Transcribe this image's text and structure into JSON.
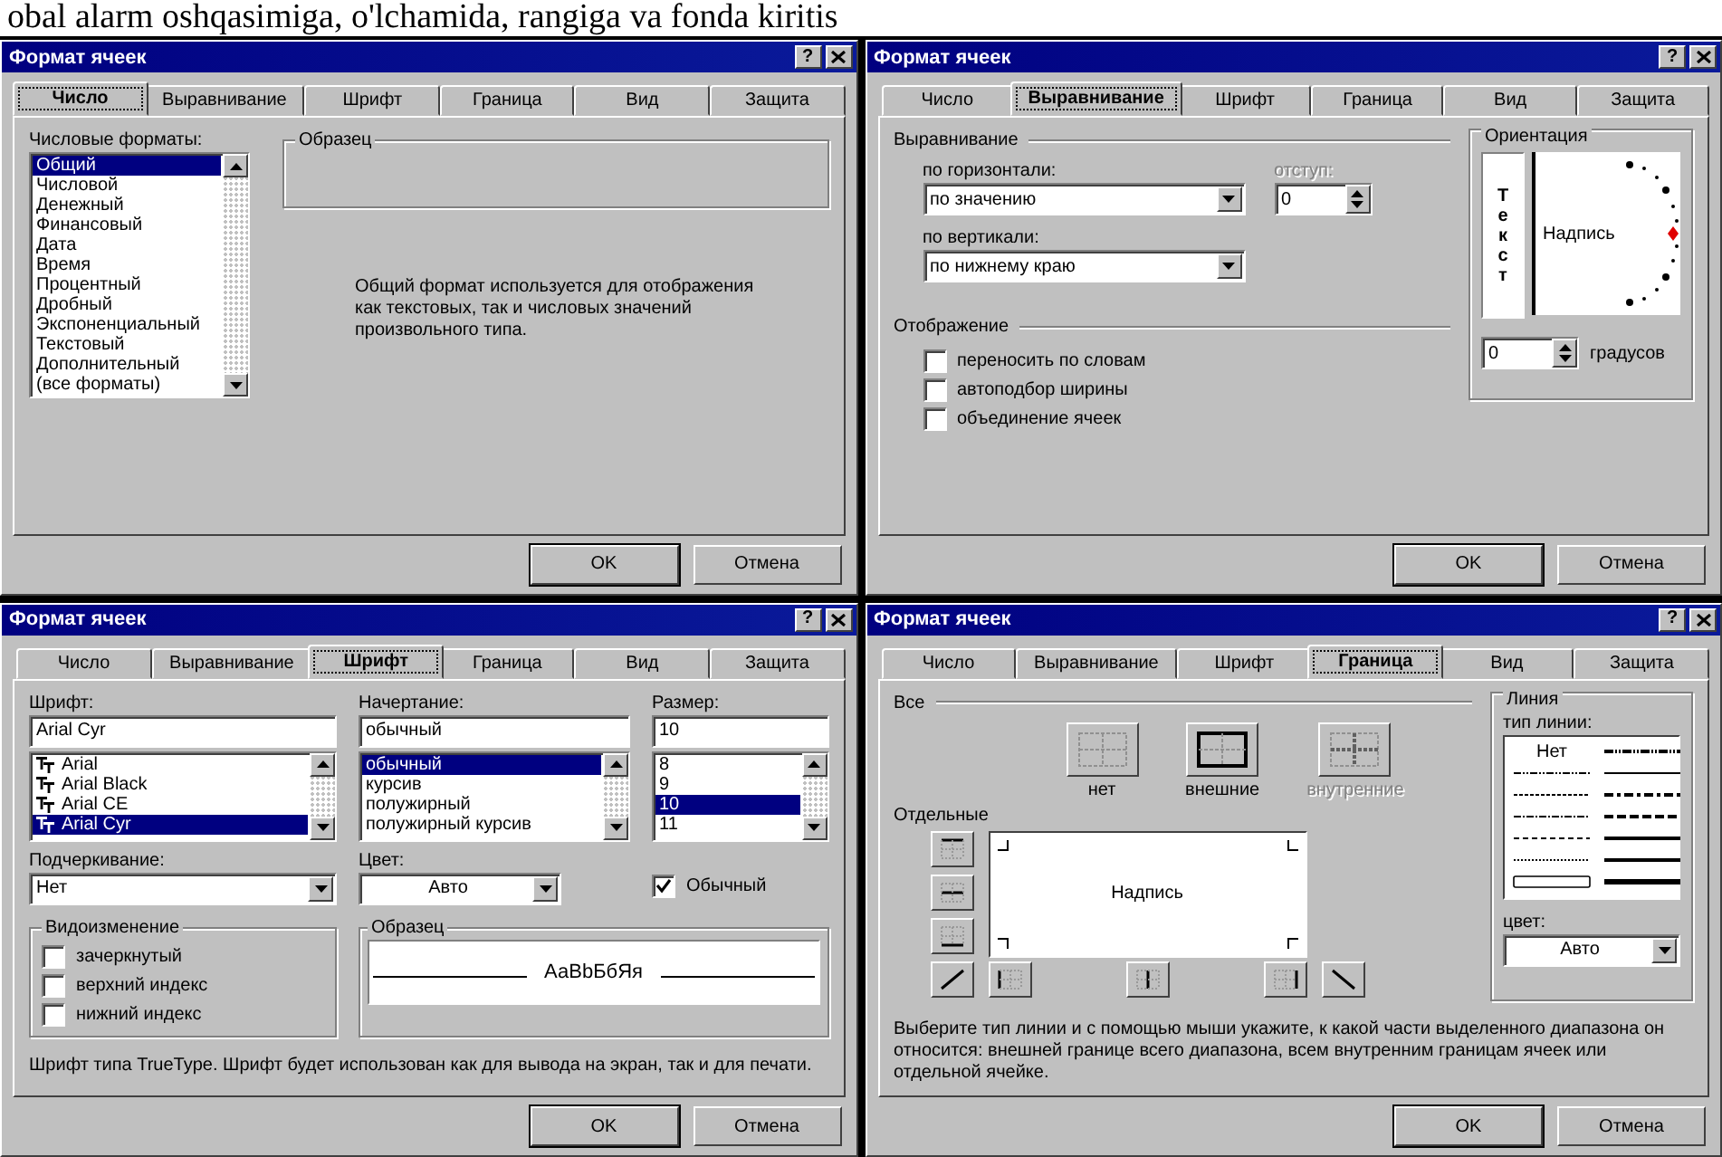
{
  "heading": "obal alarm oshqasimiga, o'lchamida, rangiga va fonda kiritis",
  "dialogs": [
    {
      "kind": "number",
      "title": "Формат ячеек",
      "help": "?",
      "tabs": [
        {
          "label": "Число",
          "selected": true
        },
        {
          "label": "Выравнивание",
          "selected": false
        },
        {
          "label": "Шрифт",
          "selected": false
        },
        {
          "label": "Граница",
          "selected": false
        },
        {
          "label": "Вид",
          "selected": false
        },
        {
          "label": "Защита",
          "selected": false
        }
      ],
      "formats_label": "Числовые форматы:",
      "formats": [
        {
          "label": "Общий",
          "selected": true
        },
        {
          "label": "Числовой",
          "selected": false
        },
        {
          "label": "Денежный",
          "selected": false
        },
        {
          "label": "Финансовый",
          "selected": false
        },
        {
          "label": "Дата",
          "selected": false
        },
        {
          "label": "Время",
          "selected": false
        },
        {
          "label": "Процентный",
          "selected": false
        },
        {
          "label": "Дробный",
          "selected": false
        },
        {
          "label": "Экспоненциальный",
          "selected": false
        },
        {
          "label": "Текстовый",
          "selected": false
        },
        {
          "label": "Дополнительный",
          "selected": false
        },
        {
          "label": "(все форматы)",
          "selected": false
        }
      ],
      "sample_group": "Образец",
      "description": "Общий формат используется для отображения как текстовых, так и числовых значений произвольного типа.",
      "buttons": [
        "OK",
        "Отмена"
      ]
    },
    {
      "kind": "alignment",
      "title": "Формат ячеек",
      "help": "?",
      "tabs": [
        {
          "label": "Число",
          "selected": false
        },
        {
          "label": "Выравнивание",
          "selected": true
        },
        {
          "label": "Шрифт",
          "selected": false
        },
        {
          "label": "Граница",
          "selected": false
        },
        {
          "label": "Вид",
          "selected": false
        },
        {
          "label": "Защита",
          "selected": false
        }
      ],
      "alignment_group": "Выравнивание",
      "horizontal_label": "по горизонтали:",
      "horizontal_value": "по значению",
      "indent_label": "отступ:",
      "indent_disabled": true,
      "indent_value": "0",
      "vertical_label": "по вертикали:",
      "vertical_value": "по нижнему краю",
      "display_group": "Отображение",
      "options": [
        {
          "label": "переносить по словам",
          "checked": false
        },
        {
          "label": "автоподбор ширины",
          "checked": false
        },
        {
          "label": "объединение ячеек",
          "checked": false
        }
      ],
      "orientation_group": "Ориентация",
      "vertical_text": "Текст",
      "dial_label": "Надпись",
      "degrees_value": "0",
      "degrees_label": "градусов",
      "buttons": [
        "OK",
        "Отмена"
      ]
    },
    {
      "kind": "font",
      "title": "Формат ячеек",
      "help": "?",
      "tabs": [
        {
          "label": "Число",
          "selected": false
        },
        {
          "label": "Выравнивание",
          "selected": false
        },
        {
          "label": "Шрифт",
          "selected": true
        },
        {
          "label": "Граница",
          "selected": false
        },
        {
          "label": "Вид",
          "selected": false
        },
        {
          "label": "Защита",
          "selected": false
        }
      ],
      "font_label": "Шрифт:",
      "font_value": "Arial Cyr",
      "fonts": [
        {
          "label": "Arial",
          "selected": false
        },
        {
          "label": "Arial Black",
          "selected": false
        },
        {
          "label": "Arial CE",
          "selected": false
        },
        {
          "label": "Arial Cyr",
          "selected": true
        }
      ],
      "style_label": "Начертание:",
      "style_value": "обычный",
      "styles": [
        {
          "label": "обычный",
          "selected": true
        },
        {
          "label": "курсив",
          "selected": false
        },
        {
          "label": "полужирный",
          "selected": false
        },
        {
          "label": "полужирный курсив",
          "selected": false
        }
      ],
      "size_label": "Размер:",
      "size_value": "10",
      "sizes": [
        {
          "label": "8",
          "selected": false
        },
        {
          "label": "9",
          "selected": false
        },
        {
          "label": "10",
          "selected": true
        },
        {
          "label": "11",
          "selected": false
        }
      ],
      "underline_label": "Подчеркивание:",
      "underline_value": "Нет",
      "color_label": "Цвет:",
      "color_value": "Авто",
      "normal": {
        "label": "Обычный",
        "checked": true
      },
      "effects_group": "Видоизменение",
      "effects": [
        {
          "label": "зачеркнутый",
          "checked": false
        },
        {
          "label": "верхний индекс",
          "checked": false
        },
        {
          "label": "нижний индекс",
          "checked": false
        }
      ],
      "sample_group": "Образец",
      "sample_text": "АаBbБбЯя",
      "note": "Шрифт типа TrueType. Шрифт будет использован как для вывода на экран, так и для печати.",
      "buttons": [
        "OK",
        "Отмена"
      ]
    },
    {
      "kind": "border",
      "title": "Формат ячеек",
      "help": "?",
      "tabs": [
        {
          "label": "Число",
          "selected": false
        },
        {
          "label": "Выравнивание",
          "selected": false
        },
        {
          "label": "Шрифт",
          "selected": false
        },
        {
          "label": "Граница",
          "selected": true
        },
        {
          "label": "Вид",
          "selected": false
        },
        {
          "label": "Защита",
          "selected": false
        }
      ],
      "presets_group": "Все",
      "presets": [
        {
          "label": "нет",
          "kind": "none",
          "disabled": false
        },
        {
          "label": "внешние",
          "kind": "outline",
          "disabled": false
        },
        {
          "label": "внутренние",
          "kind": "inside",
          "disabled": true
        }
      ],
      "separate_label": "Отдельные",
      "preview_text": "Надпись",
      "line_group": "Линия",
      "line_type_label": "тип линии:",
      "line_styles": [
        {
          "kind": "none",
          "label": "Нет"
        },
        {
          "kind": "dash-dot-dot"
        },
        {
          "kind": "dotted"
        },
        {
          "kind": "dash-dot"
        },
        {
          "kind": "dashed"
        },
        {
          "kind": "hair"
        },
        {
          "kind": "double"
        },
        {
          "kind": "medium-dash-dot-dot"
        },
        {
          "kind": "thin"
        },
        {
          "kind": "medium-dash-dot"
        },
        {
          "kind": "medium-dashed"
        },
        {
          "kind": "medium"
        },
        {
          "kind": "medium"
        },
        {
          "kind": "thick"
        }
      ],
      "line_color_label": "цвет:",
      "line_color_value": "Авто",
      "note": "Выберите тип линии и с помощью мыши укажите, к какой части выделенного диапазона он относится: внешней границе всего диапазона, всем внутренним границам ячеек или отдельной ячейке.",
      "buttons": [
        "OK",
        "Отмена"
      ]
    }
  ]
}
